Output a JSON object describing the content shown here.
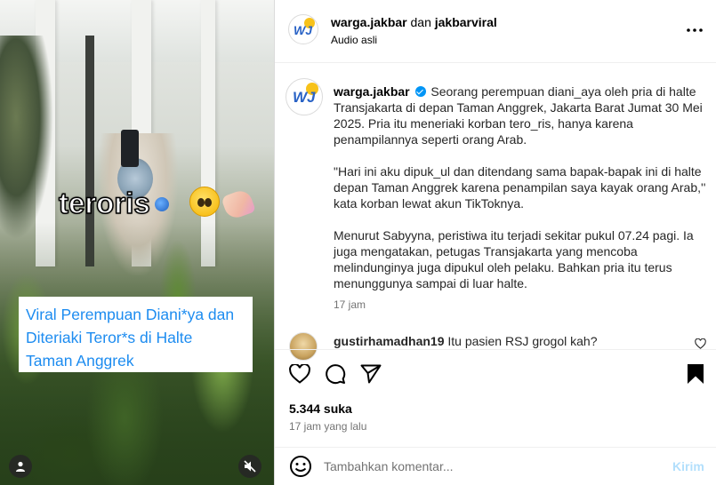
{
  "media": {
    "overlay_word": "teroris",
    "caption_lines": [
      "Viral Perempuan Diani*ya dan",
      "Diteriaki Teror*s di Halte",
      "Taman Anggrek"
    ],
    "user_icon": "user-icon",
    "mute_icon": "speaker-muted-icon"
  },
  "header": {
    "avatar_text": "WJ",
    "author": "warga.jakbar",
    "joiner": " dan ",
    "coauthor": "jakbarviral",
    "audio": "Audio asli",
    "more_icon": "more-dots-icon"
  },
  "caption": {
    "username": "warga.jakbar",
    "avatar_text": "WJ",
    "para1": "Seorang perempuan diani_aya oleh pria di halte Transjakarta di depan Taman Anggrek, Jakarta Barat Jumat 30 Mei 2025. Pria itu meneriaki korban tero_ris, hanya karena penampilannya seperti orang Arab.",
    "para2": "\"Hari ini aku dipuk_ul dan ditendang sama bapak-bapak ini di halte depan Taman Anggrek karena penampilan saya kayak orang Arab,'' kata korban lewat akun TikToknya.",
    "para3": "Menurut Sabyyna, peristiwa itu terjadi sekitar pukul 07.24 pagi. Ia juga mengatakan, petugas Transjakarta yang mencoba melindunginya juga dipukul oleh pelaku. Bahkan pria itu terus menunggunya sampai di luar halte.",
    "time": "17 jam"
  },
  "comment": {
    "username": "gustirhamadhan19",
    "text": "Itu pasien RSJ grogol kah?"
  },
  "actions": {
    "likes": "5.344 suka",
    "ago": "17 jam yang lalu"
  },
  "comment_box": {
    "placeholder": "Tambahkan komentar...",
    "send_label": "Kirim"
  },
  "colors": {
    "verified": "#0095f6",
    "caption_link": "#1d8cf0",
    "send_disabled": "#b2dffc"
  }
}
